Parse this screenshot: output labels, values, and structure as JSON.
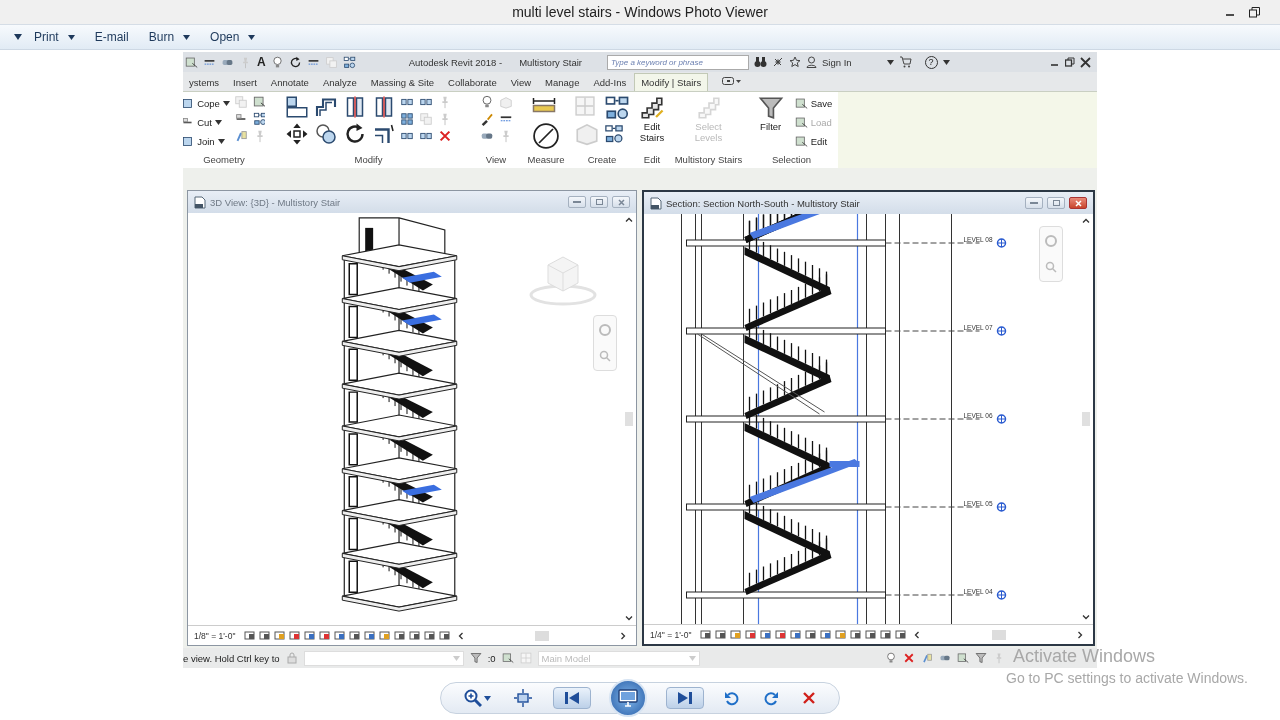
{
  "window": {
    "title": "multi level stairs - Windows Photo Viewer"
  },
  "menu": [
    {
      "label": "Print",
      "dropdown": true
    },
    {
      "label": "E-mail",
      "dropdown": false
    },
    {
      "label": "Burn",
      "dropdown": true
    },
    {
      "label": "Open",
      "dropdown": true
    }
  ],
  "revit": {
    "quick_access": {
      "text_tool": "A",
      "app_title": "Autodesk Revit 2018 -",
      "document_title": "Multistory Stair",
      "search": {
        "placeholder": "Type a keyword or phrase"
      },
      "sign_in": "Sign In",
      "help": "?"
    },
    "tabs": [
      {
        "label": "ystems",
        "selected": false
      },
      {
        "label": "Insert",
        "selected": false
      },
      {
        "label": "Annotate",
        "selected": false
      },
      {
        "label": "Analyze",
        "selected": false
      },
      {
        "label": "Massing & Site",
        "selected": false
      },
      {
        "label": "Collaborate",
        "selected": false
      },
      {
        "label": "View",
        "selected": false
      },
      {
        "label": "Manage",
        "selected": false
      },
      {
        "label": "Add-Ins",
        "selected": false
      },
      {
        "label": "Modify | Stairs",
        "selected": true
      }
    ],
    "panels": [
      {
        "label": "Geometry",
        "kind": "geometry",
        "tools": [
          {
            "label": "Cope",
            "disabled": false
          },
          {
            "label": "Cut",
            "disabled": false
          },
          {
            "label": "Join",
            "disabled": false
          }
        ]
      },
      {
        "label": "Modify",
        "kind": "modify"
      },
      {
        "label": "View",
        "kind": "view"
      },
      {
        "label": "Measure",
        "kind": "measure"
      },
      {
        "label": "Create",
        "kind": "create"
      },
      {
        "label": "Edit",
        "kind": "large",
        "tools": [
          {
            "label": "Edit Stairs",
            "kind": "stairs",
            "disabled": false
          }
        ]
      },
      {
        "label": "Multistory Stairs",
        "kind": "large",
        "tools": [
          {
            "label": "Select Levels",
            "kind": "levels",
            "disabled": true
          }
        ]
      },
      {
        "label": "Selection",
        "kind": "selection",
        "tools": [
          {
            "label": "Filter",
            "kind": "filter",
            "disabled": false
          },
          {
            "label": "Save",
            "kind": "small",
            "disabled": false
          },
          {
            "label": "Load",
            "kind": "small",
            "disabled": true
          },
          {
            "label": "Edit",
            "kind": "small",
            "disabled": false
          }
        ]
      }
    ],
    "views": [
      {
        "kind": "isometric",
        "title": "3D View: {3D} - Multistory Stair",
        "active": false,
        "scale": "1/8\" = 1'-0\""
      },
      {
        "kind": "section",
        "title": "Section: Section North-South - Multistory Stair",
        "active": true,
        "scale": "1/4\" = 1'-0\"",
        "levels": [
          "LEVEL 08",
          "LEVEL 07",
          "LEVEL 06",
          "LEVEL 05",
          "LEVEL 04"
        ]
      }
    ],
    "status_bar": {
      "hint": "e view. Hold Ctrl key to",
      "selection_count": ":0",
      "workset": "Main Model"
    }
  },
  "activation_notice": {
    "title": "Activate Windows",
    "message": "Go to PC settings to activate Windows."
  }
}
